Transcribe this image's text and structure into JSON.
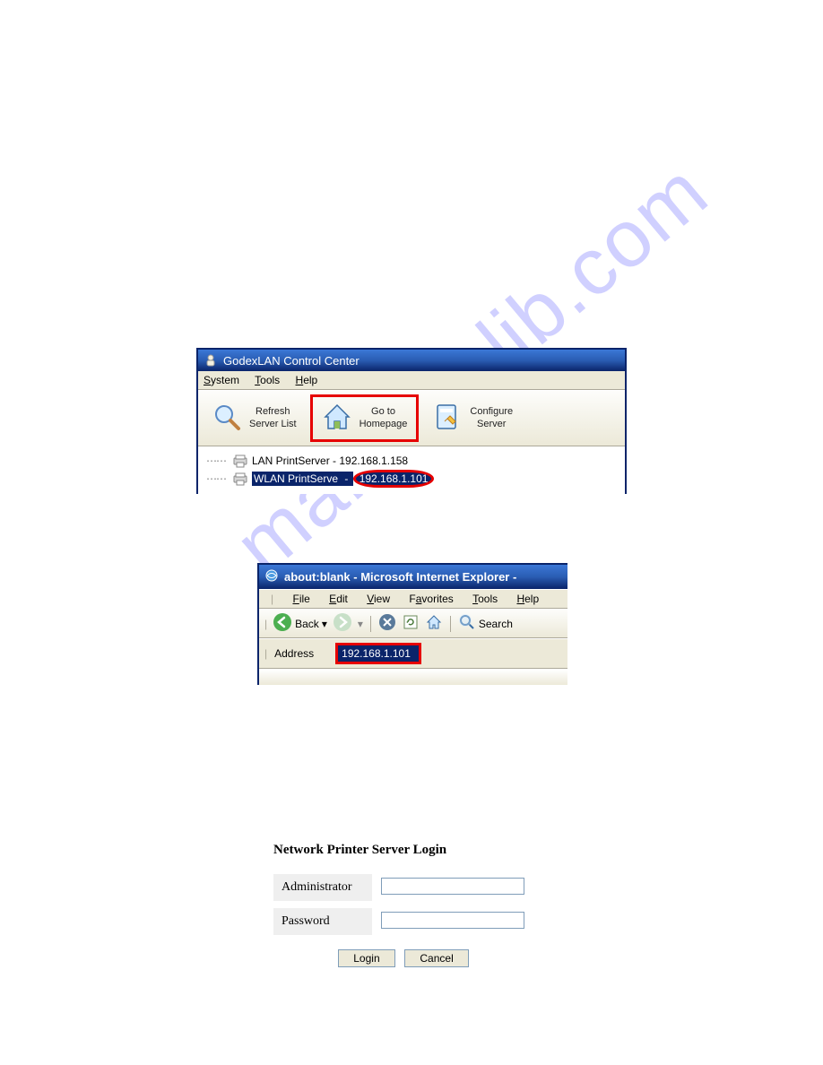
{
  "watermark": "manualslib.com",
  "win1": {
    "title": "GodexLAN Control Center",
    "menu": {
      "system": "System",
      "tools": "Tools",
      "help": "Help"
    },
    "toolbar": {
      "refresh_l1": "Refresh",
      "refresh_l2": "Server List",
      "goto_l1": "Go to",
      "goto_l2": "Homepage",
      "config_l1": "Configure",
      "config_l2": "Server"
    },
    "tree": {
      "row1": "LAN PrintServer - 192.168.1.158",
      "row2_name": "WLAN PrintServe",
      "row2_sep": " - ",
      "row2_ip": "192.168.1.101"
    }
  },
  "win2": {
    "title": "about:blank - Microsoft Internet Explorer -",
    "menu": {
      "file": "File",
      "edit": "Edit",
      "view": "View",
      "favorites": "Favorites",
      "tools": "Tools",
      "help": "Help"
    },
    "toolbar": {
      "back": "Back",
      "search": "Search"
    },
    "address_label": "Address",
    "address_value": "192.168.1.101"
  },
  "login": {
    "title": "Network Printer Server Login",
    "admin_label": "Administrator",
    "password_label": "Password",
    "login_btn": "Login",
    "cancel_btn": "Cancel"
  }
}
